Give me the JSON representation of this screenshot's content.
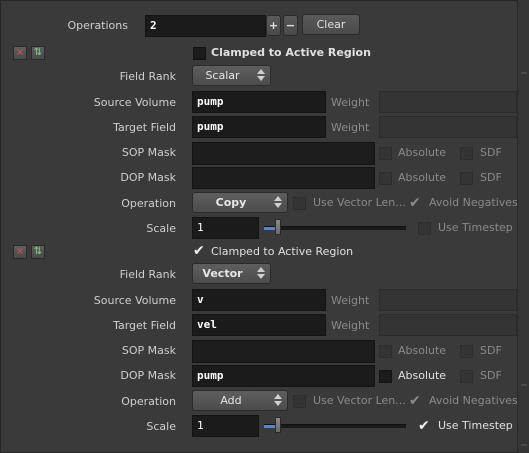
{
  "operations": {
    "label": "Operations",
    "value": "2",
    "add": "+",
    "remove": "−",
    "clear": "Clear"
  },
  "ops": [
    {
      "remove_icon": "×",
      "move_icon": "⇅",
      "clamped_label": "Clamped to Active Region",
      "clamped_checked": false,
      "field_rank_label": "Field Rank",
      "field_rank_value": "Scalar",
      "source_volume_label": "Source Volume",
      "source_volume_value": "pump",
      "source_weight_label": "Weight",
      "target_field_label": "Target Field",
      "target_field_value": "pump",
      "target_weight_label": "Weight",
      "sop_mask_label": "SOP Mask",
      "sop_absolute_label": "Absolute",
      "sop_sdf_label": "SDF",
      "dop_mask_label": "DOP Mask",
      "dop_mask_value": "",
      "dop_absolute_label": "Absolute",
      "dop_sdf_label": "SDF",
      "operation_label": "Operation",
      "operation_value": "Copy",
      "use_vector_label": "Use Vector Len...",
      "avoid_negatives_label": "Avoid Negatives",
      "scale_label": "Scale",
      "scale_value": "1",
      "use_timestep_label": "Use Timestep",
      "use_timestep_checked": false
    },
    {
      "remove_icon": "×",
      "move_icon": "⇅",
      "clamped_label": "Clamped to Active Region",
      "clamped_checked": true,
      "field_rank_label": "Field Rank",
      "field_rank_value": "Vector",
      "source_volume_label": "Source Volume",
      "source_volume_value": "v",
      "source_weight_label": "Weight",
      "target_field_label": "Target Field",
      "target_field_value": "vel",
      "target_weight_label": "Weight",
      "sop_mask_label": "SOP Mask",
      "sop_absolute_label": "Absolute",
      "sop_sdf_label": "SDF",
      "dop_mask_label": "DOP Mask",
      "dop_mask_value": "pump",
      "dop_absolute_label": "Absolute",
      "dop_sdf_label": "SDF",
      "operation_label": "Operation",
      "operation_value": "Add",
      "use_vector_label": "Use Vector Len...",
      "avoid_negatives_label": "Avoid Negatives",
      "scale_label": "Scale",
      "scale_value": "1",
      "use_timestep_label": "Use Timestep",
      "use_timestep_checked": true
    }
  ],
  "icons": {
    "remove": "close-icon",
    "move": "reorder-arrows-icon",
    "dropdown": "updown-arrows-icon",
    "check": "checkmark-icon"
  },
  "colors": {
    "background": "#3a3a3a",
    "field": "#1b1b1b",
    "slider_accent": "#5a86c8"
  }
}
